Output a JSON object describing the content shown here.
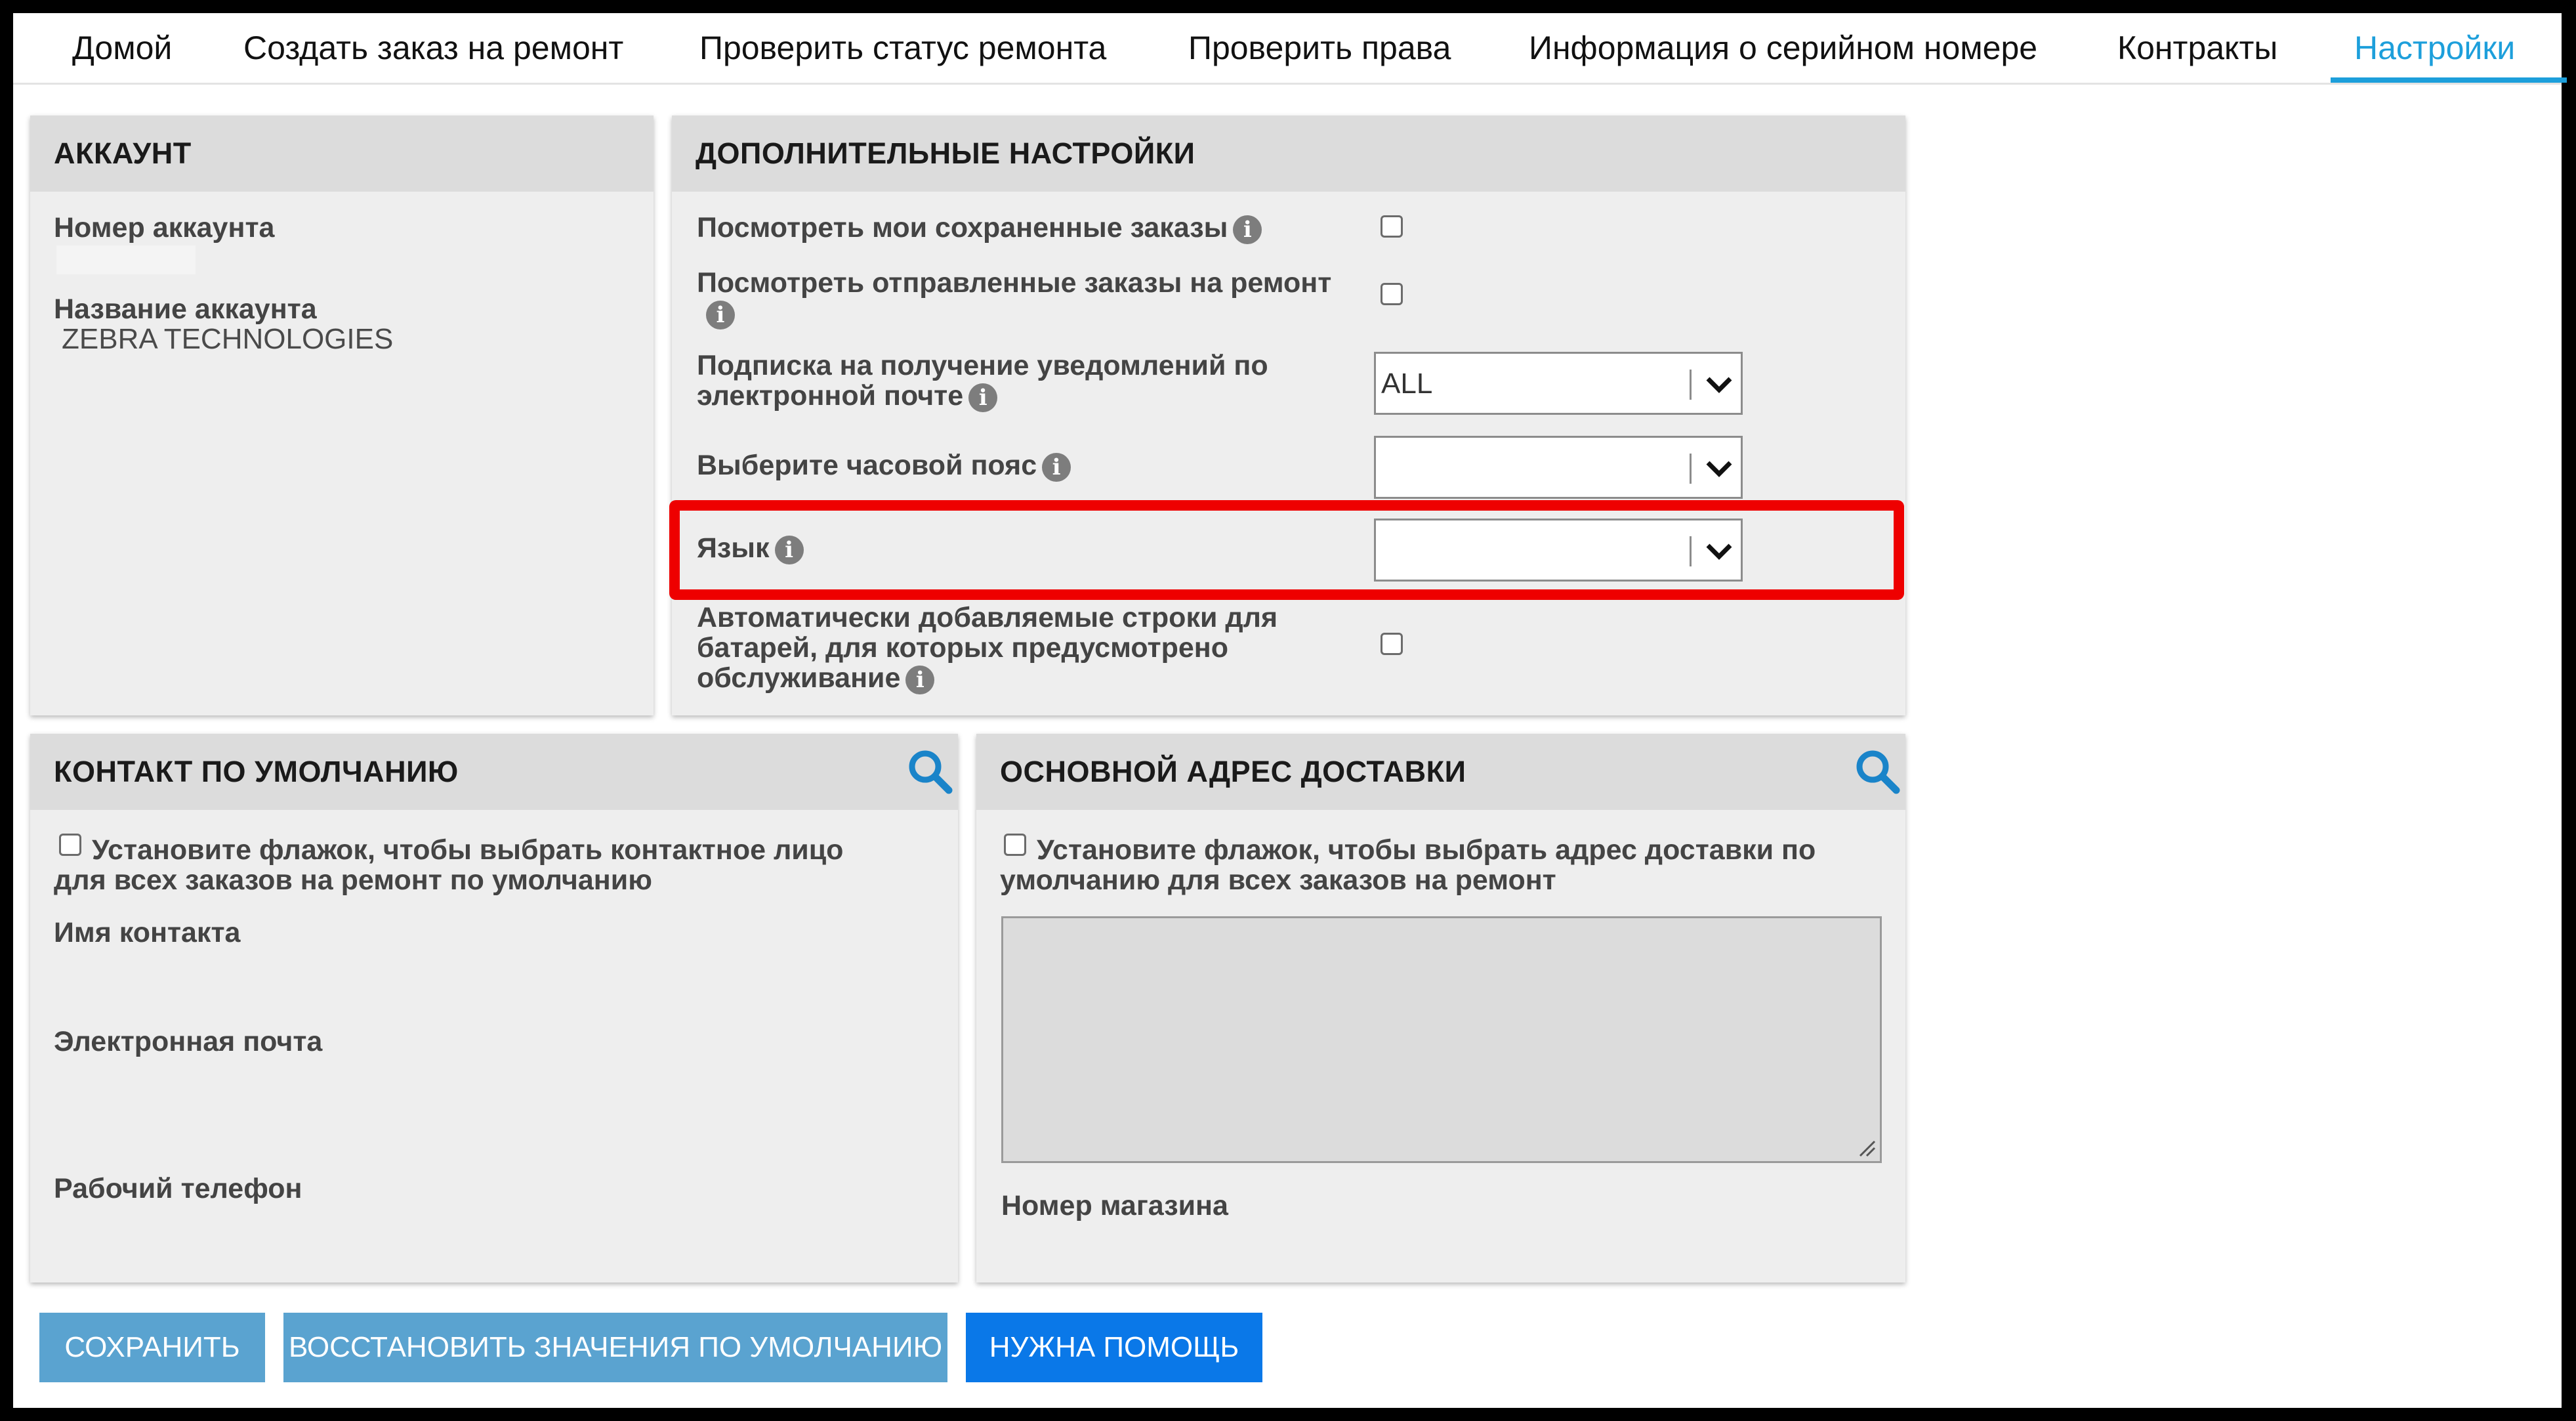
{
  "nav": {
    "tabs": [
      {
        "label": "Домой"
      },
      {
        "label": "Создать заказ на ремонт"
      },
      {
        "label": "Проверить статус ремонта"
      },
      {
        "label": "Проверить права"
      },
      {
        "label": "Информация о серийном номере"
      },
      {
        "label": "Контракты"
      },
      {
        "label": "Настройки"
      }
    ],
    "active": "Настройки"
  },
  "account": {
    "title": "АККАУНТ",
    "number_label": "Номер аккаунта",
    "number_value": "",
    "name_label": "Название аккаунта",
    "name_value": "ZEBRA TECHNOLOGIES"
  },
  "extra": {
    "title": "ДОПОЛНИТЕЛЬНЫЕ НАСТРОЙКИ",
    "saved_orders_label": "Посмотреть мои сохраненные заказы",
    "sent_orders_label": "Посмотреть отправленные заказы на ремонт",
    "email_sub_label_1": "Подписка на получение уведомлений по",
    "email_sub_label_2": "электронной почте",
    "email_sub_value": "ALL",
    "timezone_label": "Выберите часовой пояс",
    "timezone_value": "",
    "language_label": "Язык",
    "language_value": "",
    "battery_label_1": "Автоматически добавляемые строки для",
    "battery_label_2": "батарей, для которых предусмотрено",
    "battery_label_3": "обслуживание"
  },
  "contact": {
    "title": "КОНТАКТ ПО УМОЛЧАНИЮ",
    "checkbox_text_1": "Установите флажок, чтобы выбрать контактное лицо",
    "checkbox_text_2": "для всех заказов на ремонт по умолчанию",
    "name_label": "Имя контакта",
    "email_label": "Электронная почта",
    "phone_label": "Рабочий телефон"
  },
  "shipping": {
    "title": "ОСНОВНОЙ АДРЕС ДОСТАВКИ",
    "checkbox_text_1": "Установите флажок, чтобы  выбрать адрес доставки по",
    "checkbox_text_2": "умолчанию для всех заказов на ремонт",
    "store_label": "Номер магазина"
  },
  "buttons": {
    "save": "СОХРАНИТЬ",
    "restore": "ВОССТАНОВИТЬ ЗНАЧЕНИЯ ПО УМОЛЧАНИЮ",
    "help": "НУЖНА ПОМОЩЬ"
  },
  "colors": {
    "accent": "#1d9fdb",
    "panel_bg": "#eeeeee",
    "panel_header": "#dcdcdc",
    "highlight": "#ee0000",
    "button_light": "#5aa3d0",
    "button_primary": "#0a78e8"
  },
  "icons": [
    "info-icon",
    "search-icon",
    "chevron-down-icon",
    "resize-handle-icon"
  ]
}
